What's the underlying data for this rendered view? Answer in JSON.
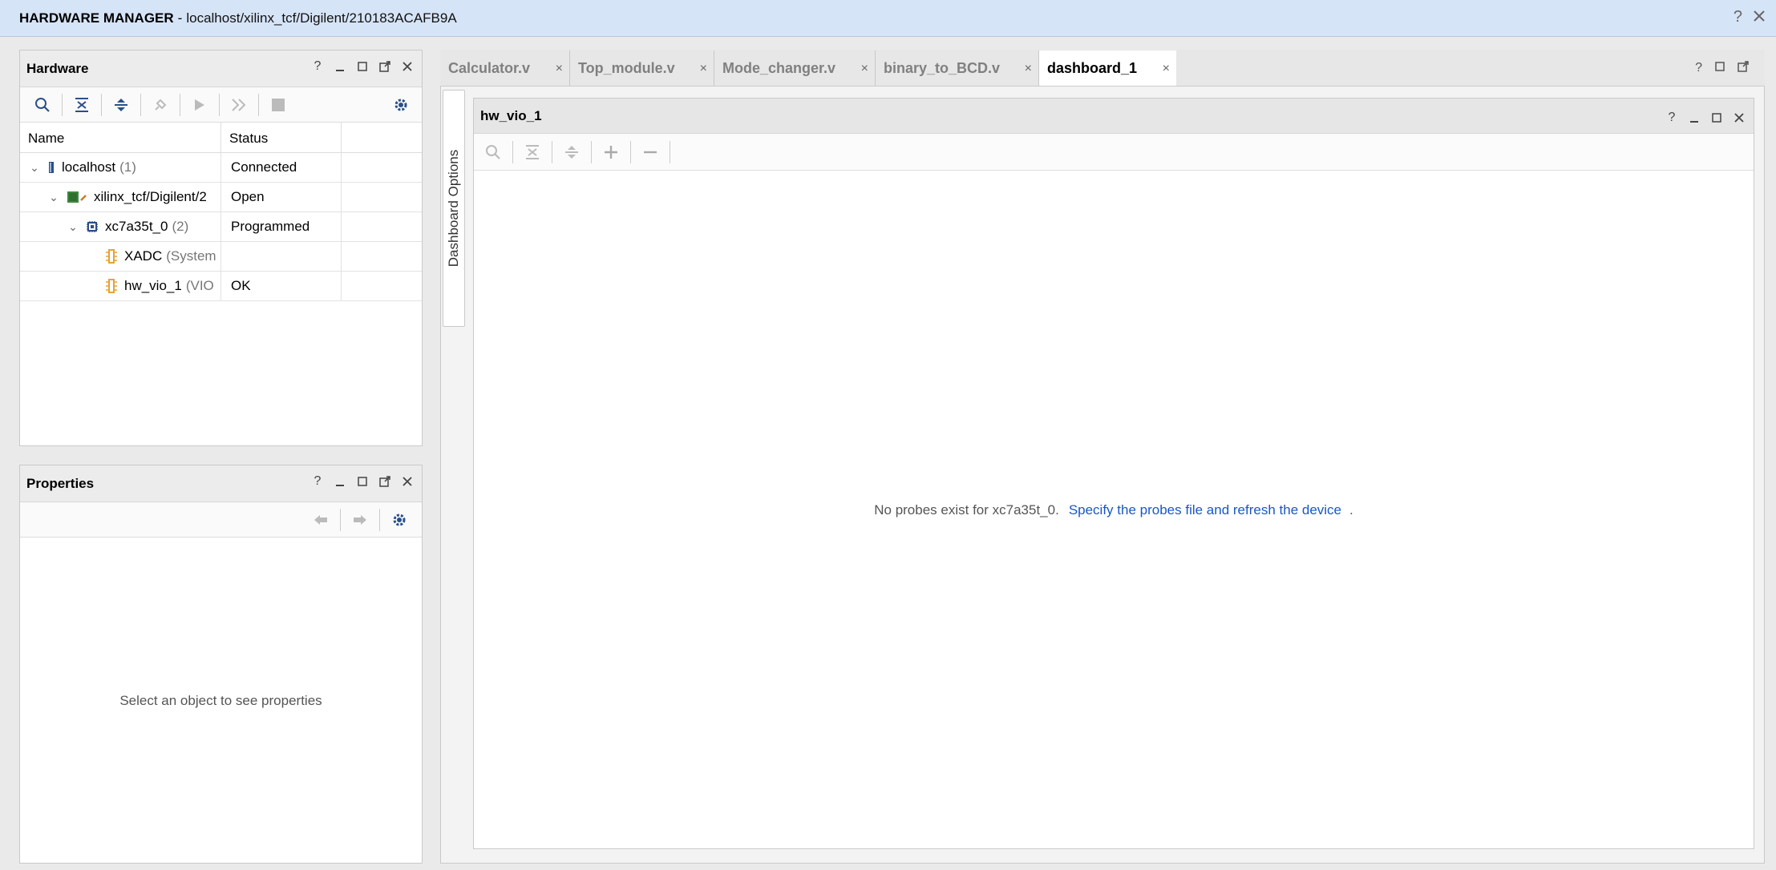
{
  "window": {
    "title_strong": "HARDWARE MANAGER",
    "title_sep": "-",
    "title_path": "localhost/xilinx_tcf/Digilent/210183ACAFB9A"
  },
  "hardware": {
    "title": "Hardware",
    "columns": {
      "name": "Name",
      "status": "Status"
    },
    "rows": [
      {
        "name": "localhost",
        "suffix": "(1)",
        "status": "Connected"
      },
      {
        "name": "xilinx_tcf/Digilent/2",
        "suffix": "",
        "status": "Open"
      },
      {
        "name": "xc7a35t_0",
        "suffix": "(2)",
        "status": "Programmed"
      },
      {
        "name": "XADC",
        "suffix": "(System",
        "status": ""
      },
      {
        "name": "hw_vio_1",
        "suffix": "(VIO",
        "status": "OK"
      }
    ]
  },
  "properties": {
    "title": "Properties",
    "empty_message": "Select an object to see properties"
  },
  "tabs": [
    {
      "label": "Calculator.v"
    },
    {
      "label": "Top_module.v"
    },
    {
      "label": "Mode_changer.v"
    },
    {
      "label": "binary_to_BCD.v"
    },
    {
      "label": "dashboard_1"
    }
  ],
  "dashboard": {
    "side_label": "Dashboard Options",
    "panel_title": "hw_vio_1",
    "message": "No probes exist for xc7a35t_0.",
    "link_text": "Specify the probes file and refresh the device",
    "trailing": "."
  },
  "colors": {
    "title_bar": "#d6e4f7",
    "link": "#1a56c8",
    "icon_blue": "#2a4f8a",
    "icon_orange": "#e8a13a"
  },
  "header_icons": {
    "help": "?",
    "minimize": "_"
  }
}
